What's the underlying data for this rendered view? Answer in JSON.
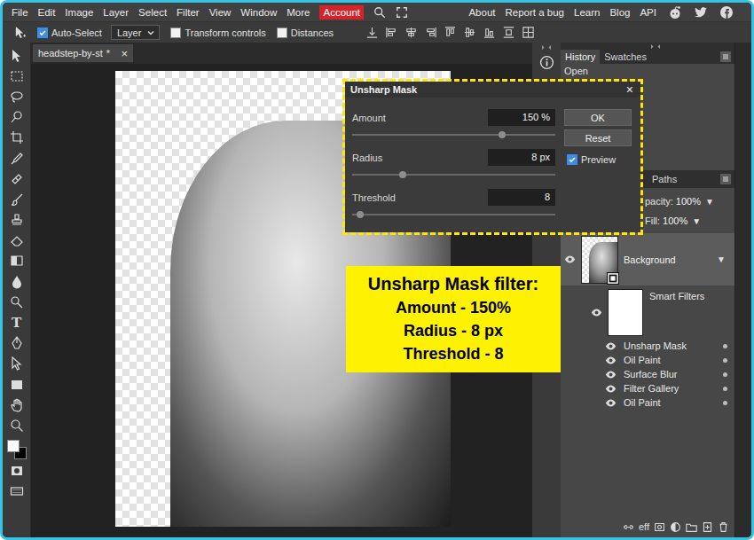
{
  "menu_bar": {
    "items": [
      "File",
      "Edit",
      "Image",
      "Layer",
      "Select",
      "Filter",
      "View",
      "Window",
      "More"
    ],
    "account": "Account",
    "links": [
      "About",
      "Report a bug",
      "Learn",
      "Blog",
      "API"
    ]
  },
  "options_bar": {
    "auto_select": {
      "label": "Auto-Select",
      "checked": true
    },
    "target": {
      "value": "Layer"
    },
    "toggles": [
      {
        "label": "Transform controls",
        "checked": false
      },
      {
        "label": "Distances",
        "checked": false
      }
    ]
  },
  "tools": {
    "type_tool": "T"
  },
  "document_tab": {
    "title": "headstep-by-st",
    "modified": "*",
    "close": "×"
  },
  "dialog": {
    "title": "Unsharp Mask",
    "close": "×",
    "fields": [
      {
        "label": "Amount",
        "value": "150 %",
        "level": 0.74
      },
      {
        "label": "Radius",
        "value": "8 px",
        "level": 0.25
      },
      {
        "label": "Threshold",
        "value": "8",
        "level": 0.04
      }
    ],
    "buttons": [
      {
        "label": "OK"
      },
      {
        "label": "Reset"
      }
    ],
    "preview": {
      "label": "Preview",
      "checked": true
    }
  },
  "annotation": {
    "title": "Unsharp Mask filter:",
    "lines": [
      "Amount - 150%",
      "Radius - 8 px",
      "Threshold - 8"
    ]
  },
  "history_panel": {
    "tabs": [
      {
        "label": "History",
        "selected": true
      },
      {
        "label": "Swatches",
        "selected": false
      }
    ],
    "items": [
      {
        "label": "Open",
        "selected": false
      }
    ]
  },
  "layers_panel": {
    "tabs": [
      {
        "label": "Paths",
        "selected": false
      }
    ],
    "opacity": {
      "label": "pacity:",
      "value": "100%",
      "arrow": "▼"
    },
    "fill": {
      "label": "Fill:",
      "value": "100%",
      "arrow": "▼"
    },
    "layers": [
      {
        "name": "Background",
        "selected": true,
        "visible": true,
        "arrow": "▼"
      }
    ],
    "smart_filters": {
      "label": "Smart Filters",
      "visible": true
    },
    "filters": [
      {
        "name": "Unsharp Mask",
        "visible": true
      },
      {
        "name": "Oil Paint",
        "visible": true
      },
      {
        "name": "Surface Blur",
        "visible": true
      },
      {
        "name": "Filter Gallery",
        "visible": true
      },
      {
        "name": "Oil Paint",
        "visible": true
      }
    ],
    "footer": {
      "effects": "eff"
    }
  }
}
